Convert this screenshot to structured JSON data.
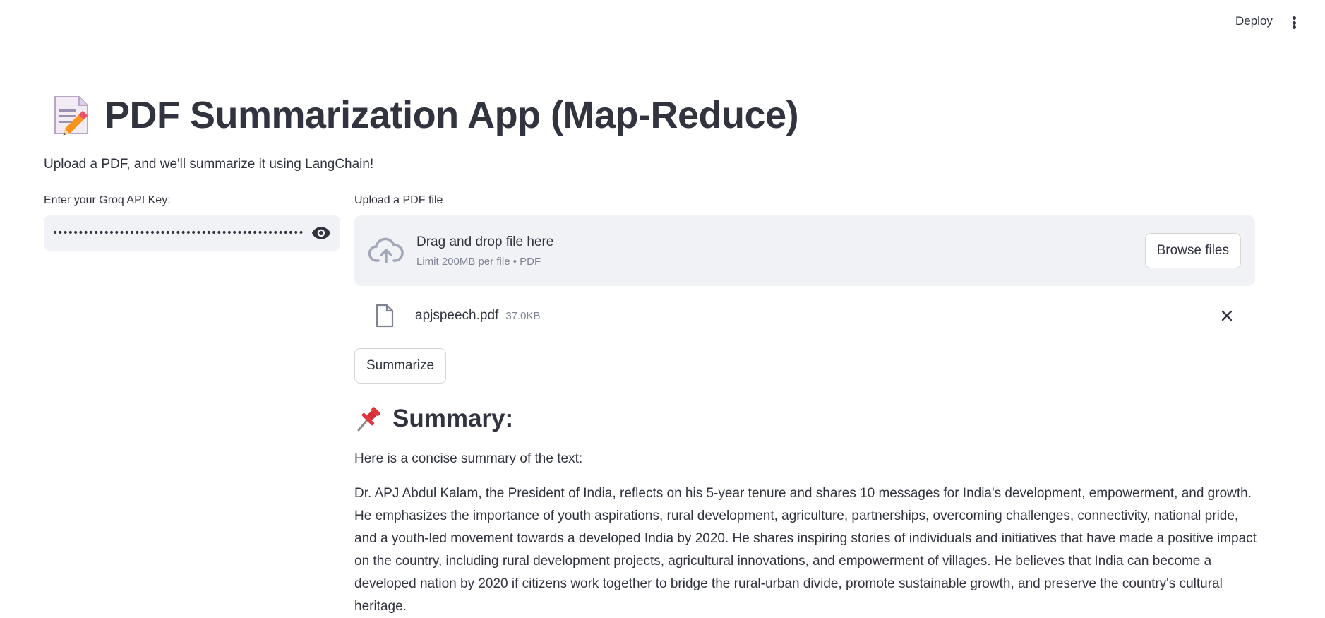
{
  "header": {
    "deploy_label": "Deploy",
    "menu_icon": "kebab-menu-icon"
  },
  "page": {
    "title_icon": "memo-emoji-icon",
    "title": "PDF Summarization App (Map-Reduce)",
    "subtitle": "Upload a PDF, and we'll summarize it using LangChain!"
  },
  "api_key": {
    "label": "Enter your Groq API Key:",
    "masked_value": "••••••••••••••••••••••••••••••••••••••••••••••••••••••••",
    "toggle_icon": "eye-icon"
  },
  "uploader": {
    "label": "Upload a PDF file",
    "drop_title": "Drag and drop file here",
    "drop_limits": "Limit 200MB per file • PDF",
    "browse_label": "Browse files",
    "upload_icon": "cloud-upload-icon"
  },
  "file": {
    "name": "apjspeech.pdf",
    "size": "37.0KB",
    "icon": "file-icon",
    "remove_icon": "close-icon"
  },
  "actions": {
    "summarize_label": "Summarize"
  },
  "summary": {
    "icon": "pushpin-emoji-icon",
    "heading": "Summary:",
    "intro": "Here is a concise summary of the text:",
    "body": "Dr. APJ Abdul Kalam, the President of India, reflects on his 5-year tenure and shares 10 messages for India's development, empowerment, and growth. He emphasizes the importance of youth aspirations, rural development, agriculture, partnerships, overcoming challenges, connectivity, national pride, and a youth-led movement towards a developed India by 2020. He shares inspiring stories of individuals and initiatives that have made a positive impact on the country, including rural development projects, agricultural innovations, and empowerment of villages. He believes that India can become a developed nation by 2020 if citizens work together to bridge the rural-urban divide, promote sustainable growth, and preserve the country's cultural heritage."
  }
}
